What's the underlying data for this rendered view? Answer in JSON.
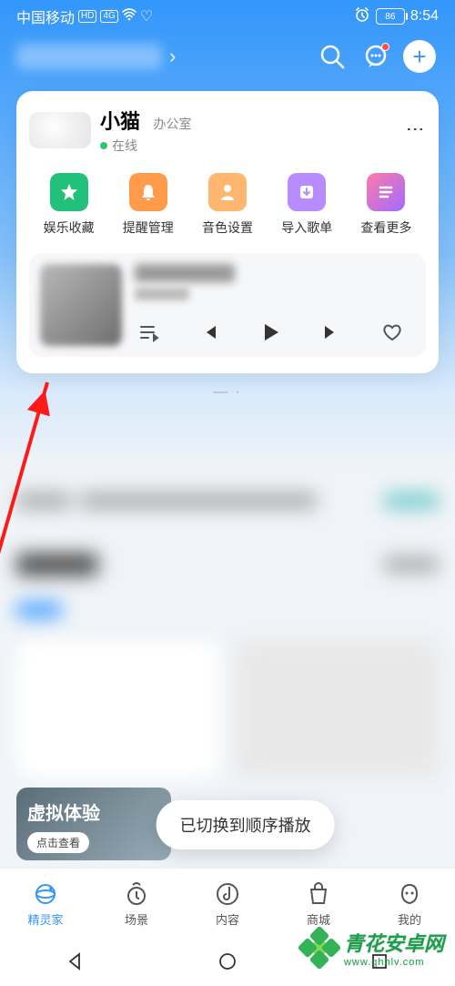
{
  "statusbar": {
    "carrier": "中国移动",
    "hd": "HD",
    "net": "4G",
    "alarm": "⏰",
    "battery": "86",
    "time": "8:54"
  },
  "topnav": {
    "search": "search-icon",
    "chat": "chat-icon",
    "add": "+"
  },
  "device": {
    "name": "小猫",
    "tag": "办公室",
    "status": "在线"
  },
  "actions": [
    {
      "icon": "star-icon",
      "label": "娱乐收藏"
    },
    {
      "icon": "bell-icon",
      "label": "提醒管理"
    },
    {
      "icon": "voice-icon",
      "label": "音色设置"
    },
    {
      "icon": "import-icon",
      "label": "导入歌单"
    },
    {
      "icon": "more-icon",
      "label": "查看更多"
    }
  ],
  "player": {
    "controls": [
      "playlist",
      "prev",
      "play",
      "next",
      "like"
    ]
  },
  "promo": {
    "title": "虚拟体验",
    "cta": "点击查看"
  },
  "toast": "已切换到顺序播放",
  "bottomnav": [
    {
      "icon": "home-icon",
      "label": "精灵家",
      "active": true
    },
    {
      "icon": "scene-icon",
      "label": "场景",
      "active": false
    },
    {
      "icon": "content-icon",
      "label": "内容",
      "active": false
    },
    {
      "icon": "mall-icon",
      "label": "商城",
      "active": false
    },
    {
      "icon": "me-icon",
      "label": "我的",
      "active": false
    }
  ],
  "watermark": {
    "brand": "青花安卓网",
    "url": "www.qhhlv.com"
  }
}
